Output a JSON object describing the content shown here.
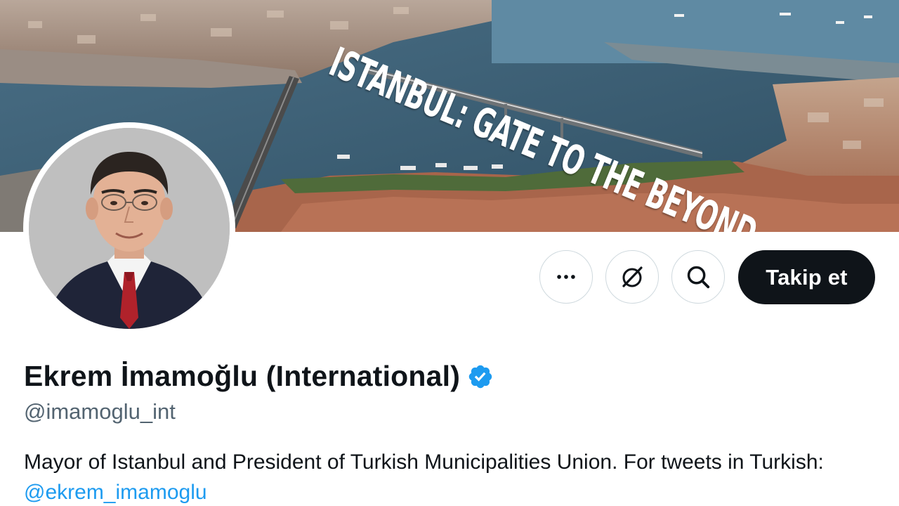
{
  "banner": {
    "overlay_text": "ISTANBUL: GATE TO THE BEYOND"
  },
  "profile": {
    "display_name": "Ekrem İmamoğlu (International)",
    "handle": "@imamoglu_int",
    "bio_text": "Mayor of Istanbul and President of Turkish Municipalities Union. For tweets in Turkish: ",
    "bio_link": "@ekrem_imamoglu",
    "verified": true
  },
  "actions": {
    "more_icon": "more-horizontal-icon",
    "grok_icon": "grok-icon",
    "search_icon": "search-icon",
    "follow_label": "Takip et"
  },
  "colors": {
    "follow_bg": "#0f1419",
    "verified_blue": "#1d9bf0",
    "link_blue": "#1d9bf0",
    "handle_gray": "#536471"
  }
}
